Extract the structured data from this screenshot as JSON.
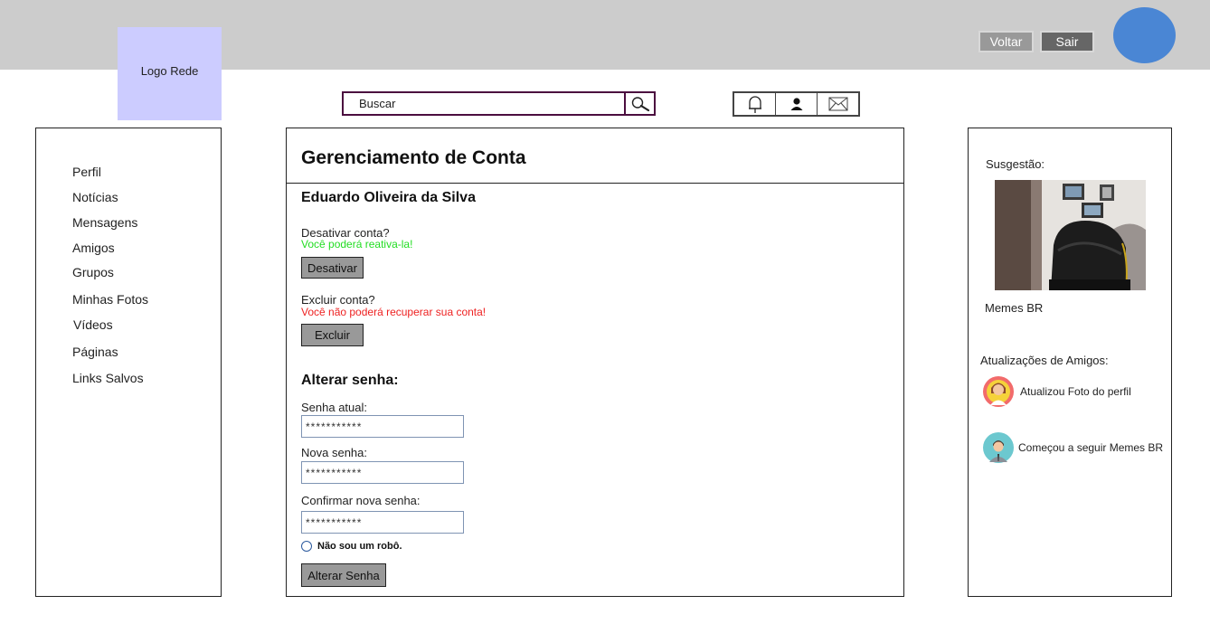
{
  "header": {
    "logo_text": "Logo Rede",
    "back_label": "Voltar",
    "logout_label": "Sair"
  },
  "search": {
    "placeholder": "Buscar"
  },
  "icon_bar": [
    "bell-icon",
    "user-icon",
    "mail-icon"
  ],
  "sidebar": {
    "items": [
      {
        "label": "Perfil"
      },
      {
        "label": "Notícias"
      },
      {
        "label": "Mensagens"
      },
      {
        "label": "Amigos"
      },
      {
        "label": "Grupos"
      },
      {
        "label": "Minhas Fotos"
      },
      {
        "label": "Vídeos"
      },
      {
        "label": "Páginas"
      },
      {
        "label": "Links Salvos"
      }
    ]
  },
  "main": {
    "title": "Gerenciamento de Conta",
    "user_name": "Eduardo Oliveira da Silva",
    "deactivate": {
      "question": "Desativar conta?",
      "hint": "Você poderá reativa-la!",
      "button": "Desativar"
    },
    "delete": {
      "question": "Excluir conta?",
      "hint": "Você não poderá recuperar sua conta!",
      "button": "Excluir"
    },
    "password": {
      "section_title": "Alterar senha:",
      "current_label": "Senha atual:",
      "current_value": "***********",
      "new_label": "Nova senha:",
      "new_value": "***********",
      "confirm_label": "Confirmar nova senha:",
      "confirm_value": "***********",
      "captcha_label": "Não sou um robô.",
      "submit": "Alterar Senha"
    }
  },
  "right": {
    "suggestion_title": "Susgestão:",
    "suggestion_name": "Memes BR",
    "updates_title": "Atualizações de Amigos:",
    "updates": [
      {
        "text": "Atualizou Foto do perfil"
      },
      {
        "text": "Começou a seguir Memes BR"
      }
    ]
  },
  "colors": {
    "topbar": "#cccccc",
    "logo_bg": "#ccccff",
    "avatar": "#4a86d4",
    "hint_green": "#22dd22",
    "hint_red": "#ee2222",
    "button_gray": "#999999"
  }
}
